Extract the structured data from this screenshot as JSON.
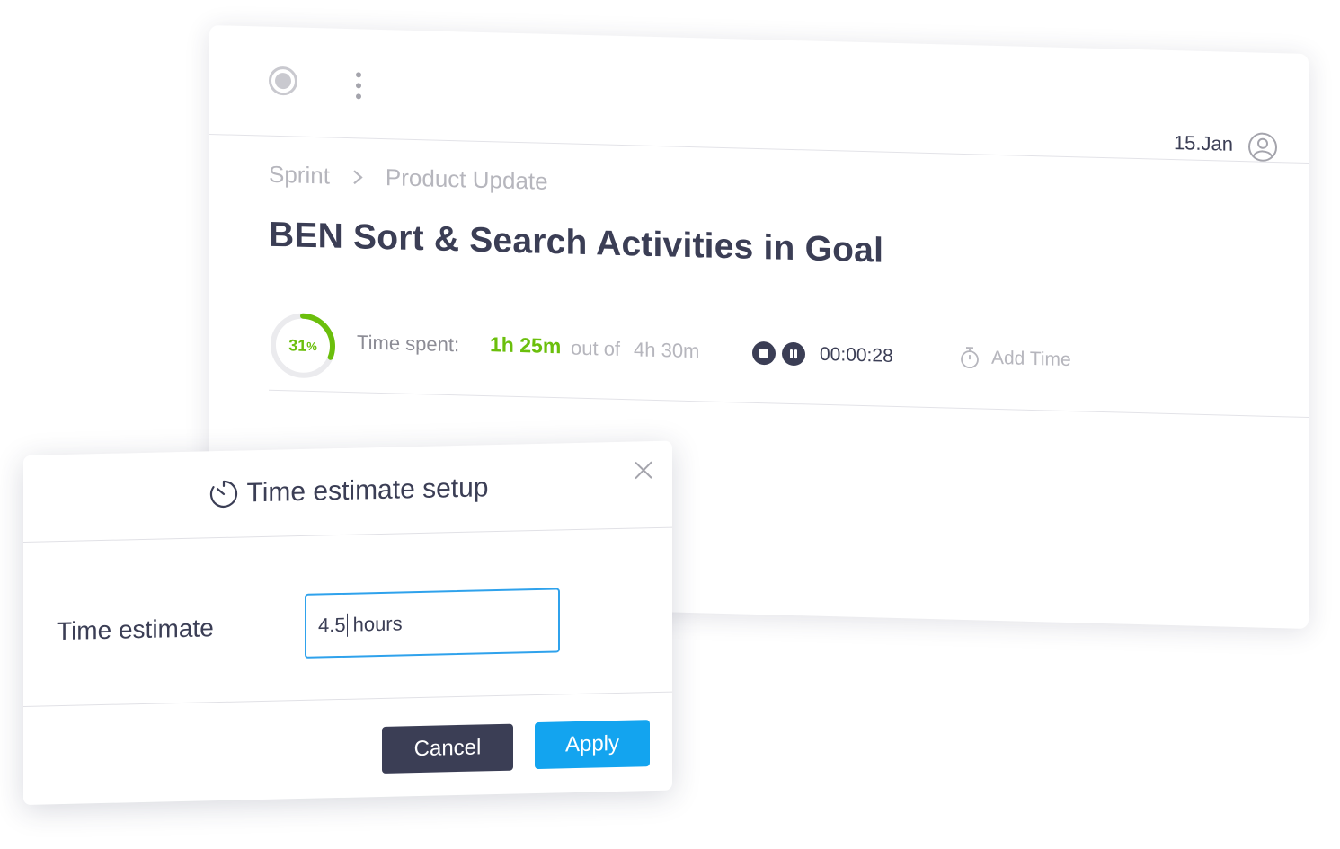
{
  "task": {
    "date": "15.Jan",
    "breadcrumb": [
      "Sprint",
      "Product Update"
    ],
    "title": "BEN Sort & Search Activities in Goal",
    "progress_value": 31,
    "progress_unit": "%",
    "time_spent_label": "Time spent:",
    "time_spent": "1h 25m",
    "out_of_label": "out of",
    "estimate": "4h 30m",
    "timer": "00:00:28",
    "add_time_label": "Add Time"
  },
  "modal": {
    "title": "Time estimate setup",
    "field_label": "Time estimate",
    "input_value": "4.5",
    "input_unit": "hours",
    "cancel_label": "Cancel",
    "apply_label": "Apply"
  },
  "colors": {
    "progress_green": "#6bbf0c",
    "accent_blue": "#13a4ef",
    "dark_navy": "#3b3e55"
  },
  "icons": [
    "status-circle-icon",
    "kebab-menu-icon",
    "user-icon",
    "chevron-right-icon",
    "stop-icon",
    "pause-icon",
    "stopwatch-icon",
    "timer-icon",
    "close-icon"
  ]
}
